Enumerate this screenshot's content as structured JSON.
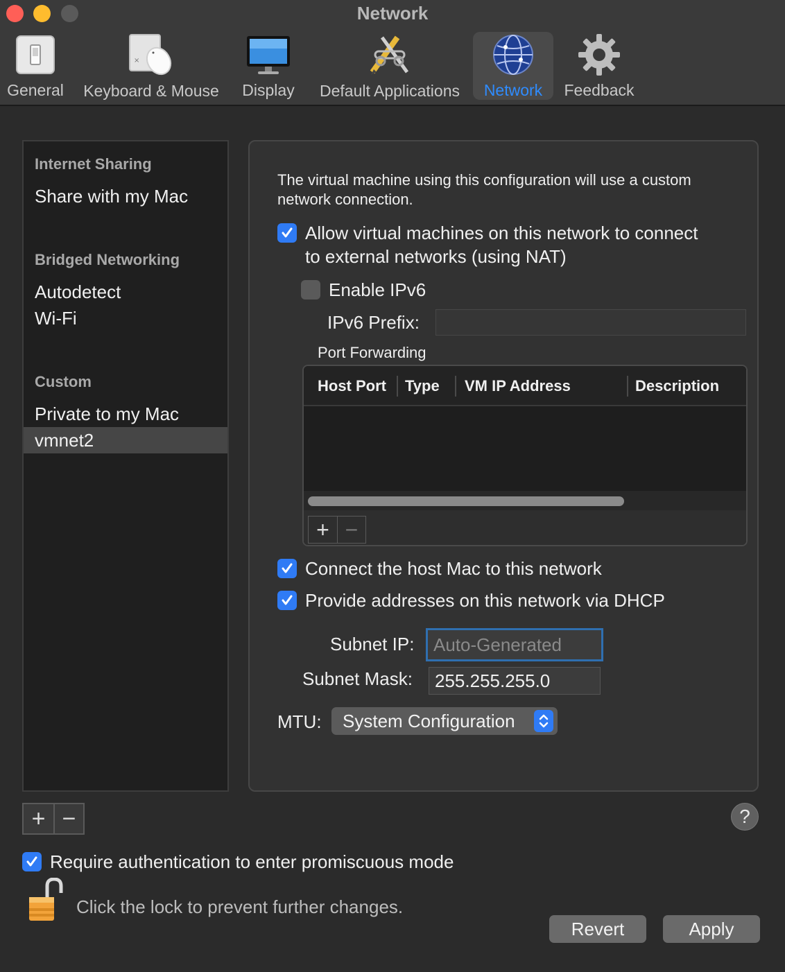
{
  "window": {
    "title": "Network"
  },
  "toolbar": {
    "items": [
      {
        "label": "General",
        "icon": "switch-icon"
      },
      {
        "label": "Keyboard & Mouse",
        "icon": "keyboard-mouse-icon"
      },
      {
        "label": "Display",
        "icon": "display-icon"
      },
      {
        "label": "Default Applications",
        "icon": "applications-icon"
      },
      {
        "label": "Network",
        "icon": "globe-icon",
        "active": true
      },
      {
        "label": "Feedback",
        "icon": "gear-icon"
      }
    ]
  },
  "sidebar": {
    "sections": [
      {
        "header": "Internet Sharing",
        "items": [
          "Share with my Mac"
        ]
      },
      {
        "header": "Bridged Networking",
        "items": [
          "Autodetect",
          "Wi-Fi"
        ]
      },
      {
        "header": "Custom",
        "items": [
          "Private to my Mac",
          "vmnet2"
        ]
      }
    ],
    "selected": "vmnet2",
    "add_symbol": "+",
    "remove_symbol": "−"
  },
  "panel": {
    "description": "The virtual machine using this configuration will use a custom network connection.",
    "nat_checkbox": {
      "label_line1": "Allow virtual machines on this network to connect",
      "label_line2": "to external networks (using NAT)",
      "checked": true
    },
    "ipv6_checkbox": {
      "label": "Enable IPv6",
      "checked": false
    },
    "ipv6_prefix": {
      "label": "IPv6 Prefix:",
      "value": ""
    },
    "port_forwarding": {
      "label": "Port Forwarding",
      "columns": [
        "Host Port",
        "Type",
        "VM IP Address",
        "Description"
      ],
      "rows": [],
      "add_symbol": "+",
      "remove_symbol": "−"
    },
    "connect_host_checkbox": {
      "label": "Connect the host Mac to this network",
      "checked": true
    },
    "dhcp_checkbox": {
      "label": "Provide addresses on this network via DHCP",
      "checked": true
    },
    "subnet_ip": {
      "label": "Subnet IP:",
      "placeholder": "Auto-Generated",
      "value": ""
    },
    "subnet_mask": {
      "label": "Subnet Mask:",
      "value": "255.255.255.0"
    },
    "mtu": {
      "label": "MTU:",
      "value": "System Configuration"
    }
  },
  "footer": {
    "help_symbol": "?",
    "promiscuous_checkbox": {
      "label": "Require authentication to enter promiscuous mode",
      "checked": true
    },
    "lock_text": "Click the lock to prevent further changes.",
    "revert_label": "Revert",
    "apply_label": "Apply"
  },
  "colors": {
    "accent": "#2f7bf5",
    "active_tab_text": "#2f8cff",
    "background": "#2b2b2b",
    "panel": "#323232"
  }
}
